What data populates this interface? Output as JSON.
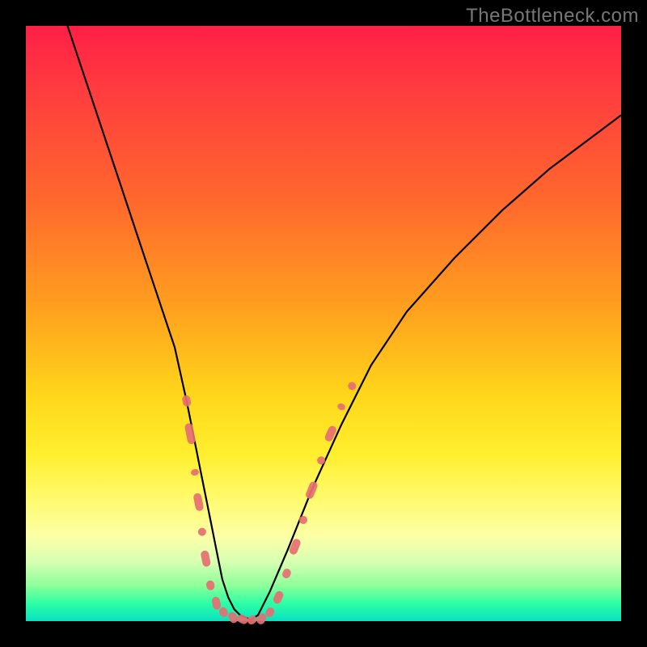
{
  "watermark": "TheBottleneck.com",
  "colors": {
    "frame": "#000000",
    "marker": "#e66f71",
    "curve": "#000000",
    "gradient_top": "#ff1f47",
    "gradient_bottom": "#08e0c2"
  },
  "chart_data": {
    "type": "line",
    "title": "",
    "xlabel": "",
    "ylabel": "",
    "xlim": [
      0,
      100
    ],
    "ylim": [
      0,
      100
    ],
    "grid": false,
    "legend": false,
    "series": [
      {
        "name": "bottleneck-curve",
        "x": [
          7,
          10,
          13,
          16,
          19,
          22,
          25,
          27,
          28,
          29,
          30,
          31,
          32,
          33,
          34,
          35,
          36,
          37.8,
          39,
          41,
          44,
          48,
          53,
          58,
          64,
          72,
          80,
          88,
          96,
          100
        ],
        "y": [
          100,
          91,
          82,
          73,
          64,
          55,
          46,
          37,
          32,
          27,
          22,
          17,
          12,
          7,
          4,
          2,
          1,
          0.2,
          1,
          5,
          12,
          22,
          33,
          43,
          52,
          61,
          69,
          76,
          82,
          85
        ]
      }
    ],
    "annotations": {
      "marker_cluster_note": "salmon capsule markers clustered along the two branches near the valley floor"
    },
    "markers": [
      {
        "x": 27.0,
        "y": 37.0,
        "len": 14
      },
      {
        "x": 27.6,
        "y": 31.5,
        "len": 26
      },
      {
        "x": 28.4,
        "y": 25.0,
        "len": 8
      },
      {
        "x": 29.0,
        "y": 20.0,
        "len": 22
      },
      {
        "x": 29.6,
        "y": 15.0,
        "len": 10
      },
      {
        "x": 30.2,
        "y": 10.5,
        "len": 20
      },
      {
        "x": 31.0,
        "y": 6.0,
        "len": 12
      },
      {
        "x": 32.0,
        "y": 3.0,
        "len": 16
      },
      {
        "x": 33.2,
        "y": 1.5,
        "len": 12
      },
      {
        "x": 34.8,
        "y": 0.6,
        "len": 14
      },
      {
        "x": 36.4,
        "y": 0.3,
        "len": 14
      },
      {
        "x": 38.0,
        "y": 0.2,
        "len": 12
      },
      {
        "x": 39.6,
        "y": 0.4,
        "len": 14
      },
      {
        "x": 41.0,
        "y": 1.5,
        "len": 12
      },
      {
        "x": 42.4,
        "y": 4.0,
        "len": 16
      },
      {
        "x": 43.8,
        "y": 8.0,
        "len": 12
      },
      {
        "x": 45.2,
        "y": 12.5,
        "len": 20
      },
      {
        "x": 46.6,
        "y": 17.0,
        "len": 10
      },
      {
        "x": 48.0,
        "y": 22.0,
        "len": 22
      },
      {
        "x": 49.6,
        "y": 27.0,
        "len": 10
      },
      {
        "x": 51.2,
        "y": 31.5,
        "len": 20
      },
      {
        "x": 53.0,
        "y": 36.0,
        "len": 8
      },
      {
        "x": 54.8,
        "y": 39.5,
        "len": 10
      }
    ]
  }
}
